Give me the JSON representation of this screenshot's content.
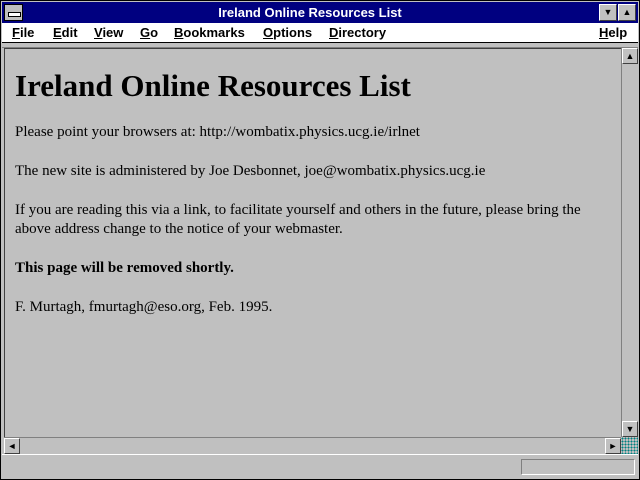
{
  "window": {
    "title": "Ireland Online Resources List"
  },
  "titlebar": {
    "minimize_glyph": "▼",
    "maximize_glyph": "▲"
  },
  "menu": {
    "items": [
      "File",
      "Edit",
      "View",
      "Go",
      "Bookmarks",
      "Options",
      "Directory"
    ],
    "help": "Help"
  },
  "page": {
    "heading": "Ireland Online Resources List",
    "paragraphs": [
      "Please point your browsers at: http://wombatix.physics.ucg.ie/irlnet",
      "The new site is administered by Joe Desbonnet, joe@wombatix.physics.ucg.ie",
      "If you are reading this via a link, to facilitate yourself and others in the future, please bring the above address change to the notice of your webmaster."
    ],
    "notice": "This page will be removed shortly.",
    "signature": "F. Murtagh, fmurtagh@eso.org, Feb. 1995."
  },
  "scrollbar": {
    "up_glyph": "▲",
    "down_glyph": "▼",
    "left_glyph": "◄",
    "right_glyph": "►"
  },
  "colors": {
    "titlebar": "#000080",
    "background": "#c0c0c0",
    "menubar": "#ffffff"
  }
}
